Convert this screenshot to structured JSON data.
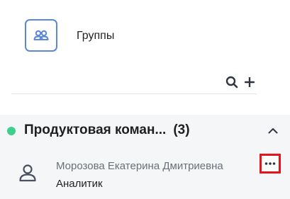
{
  "header": {
    "title": "Группы",
    "icon": "groups-icon"
  },
  "toolbar": {
    "search_icon": "search-icon",
    "add_icon": "plus-icon"
  },
  "group": {
    "name": "Продуктовая коман...",
    "count": "(3)",
    "status_color": "#3ecf8e",
    "collapse_icon": "chevron-up-icon"
  },
  "members": [
    {
      "name": "Морозова Екатерина Дмитриевна",
      "role": "Аналитик",
      "avatar_icon": "user-icon",
      "menu_icon": "more-horizontal-icon"
    }
  ],
  "colors": {
    "accent": "#5b87da",
    "highlight_border": "#e5141c",
    "section_bg": "#f5f6f8"
  }
}
